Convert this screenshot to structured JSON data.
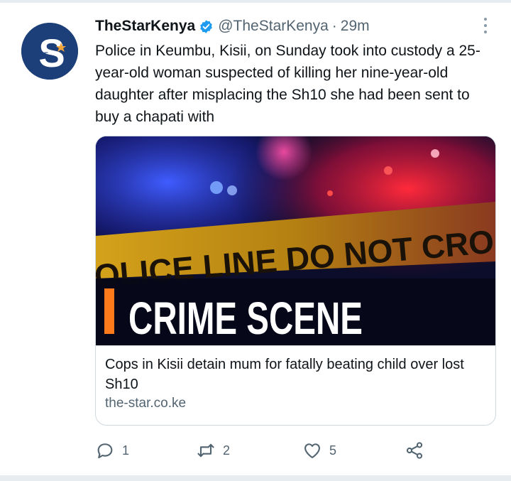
{
  "tweet": {
    "display_name": "TheStarKenya",
    "handle": "@TheStarKenya",
    "separator": "·",
    "time": "29m",
    "text": "Police in Keumbu, Kisii, on Sunday took into custody a 25-year-old woman suspected of killing her nine-year-old daughter after misplacing the Sh10 she had been sent to buy a chapati with",
    "avatar": {
      "letter": "S",
      "small_text": "THE"
    }
  },
  "card": {
    "image_banner_text": "CRIME SCENE",
    "image_tape_text": "OLICE LINE DO NOT CROS",
    "title": "Cops in Kisii detain mum for fatally beating child over lost Sh10",
    "domain": "the-star.co.ke"
  },
  "actions": {
    "reply_count": "1",
    "retweet_count": "2",
    "like_count": "5"
  },
  "colors": {
    "accent": "#1d9bf0",
    "secondary_text": "#536471",
    "avatar_bg": "#1c3f7a",
    "border": "#cfd9de"
  },
  "icons": [
    "verified-icon",
    "more-icon",
    "reply-icon",
    "retweet-icon",
    "like-icon",
    "share-icon"
  ]
}
